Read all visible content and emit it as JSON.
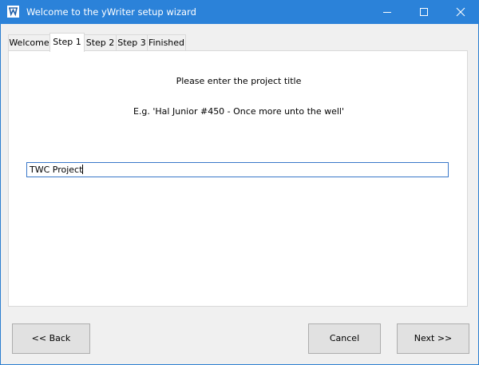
{
  "window": {
    "title": "Welcome to the yWriter setup wizard",
    "icon": "ywriter-app-icon",
    "titlebar_color": "#2b82d9"
  },
  "tabs": [
    {
      "label": "Welcome",
      "active": false
    },
    {
      "label": "Step 1",
      "active": true
    },
    {
      "label": "Step 2",
      "active": false
    },
    {
      "label": "Step 3",
      "active": false
    },
    {
      "label": "Finished",
      "active": false
    }
  ],
  "step": {
    "prompt": "Please enter the project title",
    "example": "E.g. 'Hal Junior #450 - Once more unto the well'",
    "input_value": "TWC Project"
  },
  "buttons": {
    "back": "<< Back",
    "cancel": "Cancel",
    "next": "Next >>"
  }
}
